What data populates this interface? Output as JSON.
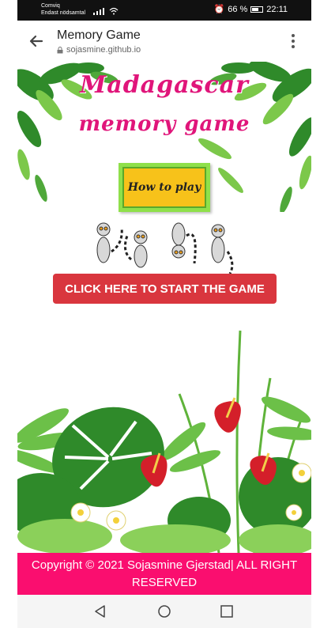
{
  "status_bar": {
    "carrier_line1": "Comviq",
    "carrier_line2": "Endast nödsamtal",
    "battery": "66 %",
    "battery_level": 0.66,
    "time": "22:11"
  },
  "browser": {
    "title": "Memory Game",
    "url": "sojasmine.github.io"
  },
  "page": {
    "logo_title": "Madagascar",
    "logo_subtitle": "memory game",
    "how_to_play_label": "How to play",
    "start_button_label": "CLICK HERE TO START THE GAME",
    "footer_text": "Copyright © 2021 Sojasmine Gjerstad| ALL RIGHT RESERVED"
  },
  "colors": {
    "logo": "#e0157a",
    "how_to_play_bg": "#f7c21a",
    "how_to_play_border": "#8fe04a",
    "start_button": "#d9363e",
    "footer": "#fa0e6f",
    "leaf_dark": "#2f8a2a",
    "leaf_light": "#7cc84a",
    "flower_red": "#d41f2a"
  },
  "icons": {
    "back": "arrow-left-icon",
    "lock": "lock-icon",
    "menu": "more-vertical-icon",
    "nav_back": "triangle-back-icon",
    "nav_home": "circle-home-icon",
    "nav_recent": "square-recent-icon"
  }
}
